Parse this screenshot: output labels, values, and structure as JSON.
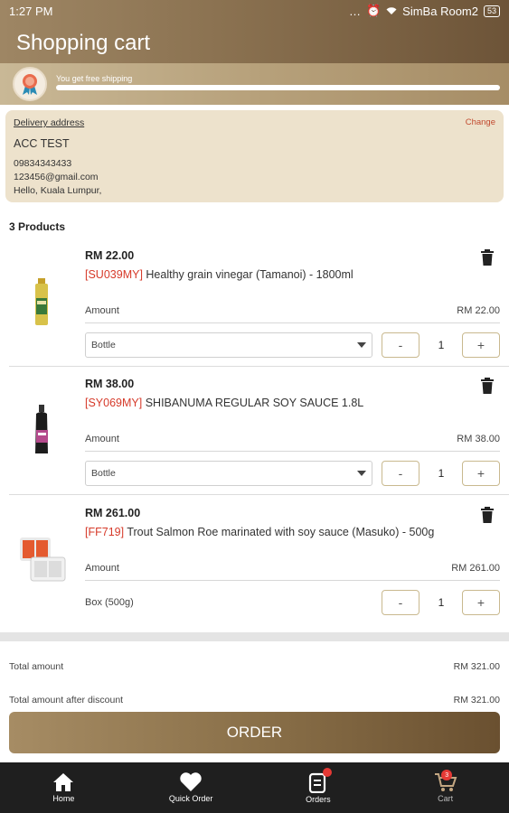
{
  "status": {
    "time": "1:27",
    "ampm": "PM",
    "carrier": "SimBa Room2",
    "battery": "53"
  },
  "header": {
    "title": "Shopping cart"
  },
  "shipping": {
    "message": "You get free shipping",
    "progress": 1.0
  },
  "address": {
    "label": "Delivery address",
    "change": "Change",
    "name": "ACC TEST",
    "phone": "09834343433",
    "email": "123456@gmail.com",
    "location": "Hello, Kuala Lumpur,"
  },
  "cart": {
    "count_label": "3 Products",
    "amount_label": "Amount",
    "items": [
      {
        "price": "RM 22.00",
        "code": "[SU039MY]",
        "name": "Healthy grain vinegar (Tamanoi) - 1800ml",
        "amount": "RM 22.00",
        "unit": "Bottle",
        "qty": "1",
        "minus": "-",
        "plus": "+"
      },
      {
        "price": "RM 38.00",
        "code": "[SY069MY]",
        "name": "SHIBANUMA REGULAR SOY SAUCE 1.8L",
        "amount": "RM 38.00",
        "unit": "Bottle",
        "qty": "1",
        "minus": "-",
        "plus": "+"
      },
      {
        "price": "RM 261.00",
        "code": "[FF719]",
        "name": "Trout Salmon Roe marinated with soy sauce (Masuko) - 500g",
        "amount": "RM 261.00",
        "unit": "Box (500g)",
        "qty": "1",
        "minus": "-",
        "plus": "+"
      }
    ]
  },
  "totals": {
    "total_label": "Total amount",
    "total_value": "RM 321.00",
    "after_discount_label": "Total amount after discount",
    "after_discount_value": "RM 321.00"
  },
  "order": {
    "label": "ORDER"
  },
  "nav": {
    "home": "Home",
    "quick_order": "Quick Order",
    "orders": "Orders",
    "cart": "Cart",
    "cart_badge": "3"
  },
  "colors": {
    "accent": "#8a7150",
    "code_red": "#d63a2a",
    "change_red": "#c24a2f"
  }
}
